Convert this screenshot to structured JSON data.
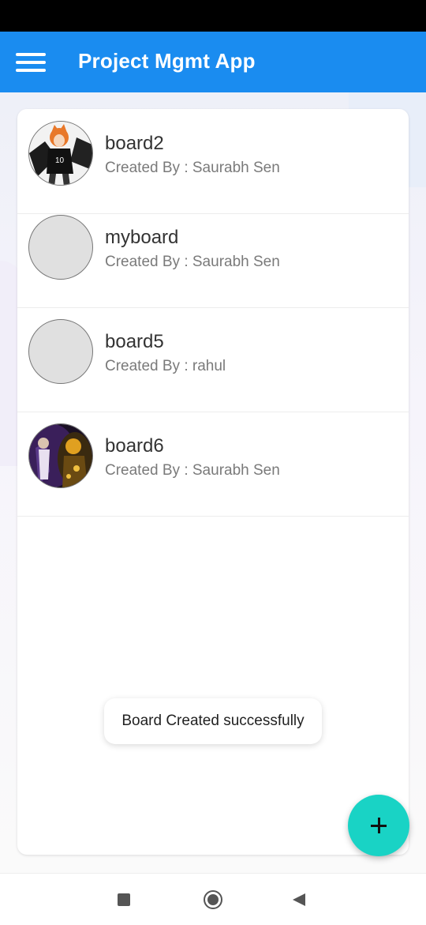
{
  "app_bar": {
    "title": "Project Mgmt App",
    "menu_icon": "hamburger-menu-icon",
    "color": "#1a8cf0"
  },
  "boards": [
    {
      "name": "board2",
      "created_by": "Created By : Saurabh Sen",
      "avatar": "anime-character-image"
    },
    {
      "name": "myboard",
      "created_by": "Created By : Saurabh Sen",
      "avatar": "placeholder"
    },
    {
      "name": "board5",
      "created_by": "Created By : rahul",
      "avatar": "placeholder"
    },
    {
      "name": "board6",
      "created_by": "Created By : Saurabh Sen",
      "avatar": "anime-character-image"
    }
  ],
  "toast": {
    "message": "Board Created successfully"
  },
  "fab": {
    "icon": "plus-icon",
    "color": "#19d3c5"
  },
  "nav_bar": {
    "icons": [
      "recents-square-icon",
      "home-circle-icon",
      "back-triangle-icon"
    ]
  }
}
